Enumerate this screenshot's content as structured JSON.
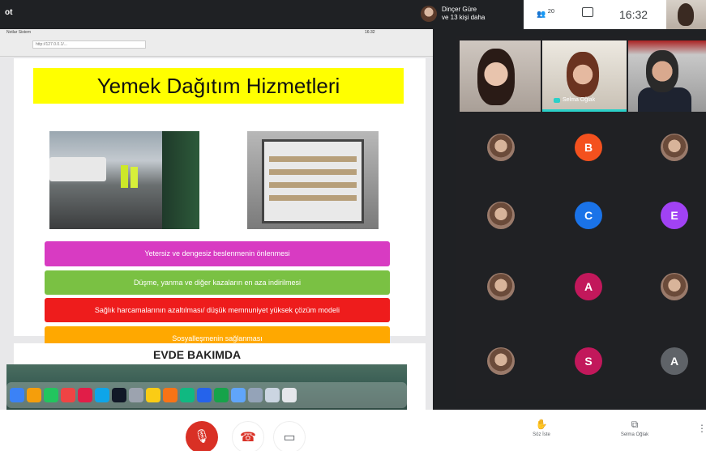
{
  "topbar": {
    "app_label": "ot",
    "presenter": {
      "line1": "Dinçer Güre",
      "line2": "ve 13 kişi daha"
    },
    "people_count": "20",
    "clock": "16:32"
  },
  "screen": {
    "browser_menu": "Notlar  Sistem",
    "url": "http://127.0.0.1/...",
    "clock_mini": "16:32",
    "slide": {
      "title": "Yemek Dağıtım Hizmetleri",
      "bars": [
        {
          "text": "Yetersiz  ve dengesiz beslenmenin önlenmesi",
          "color": "#d83bc2"
        },
        {
          "text": "Düşme, yanma ve diğer kazaların en aza indirilmesi",
          "color": "#7ac143"
        },
        {
          "text": "Sağlık harcamalarının azaltılması/  düşük memnuniyet yüksek çözüm modeli",
          "color": "#ee1c1c"
        },
        {
          "text": "Sosyalleşmenin sağlanması",
          "color": "#ffa800"
        }
      ]
    },
    "slide2_heading": "EVDE BAKIMDA"
  },
  "panel": {
    "tile2_name": "Selma Oğlak",
    "avatars": [
      {
        "letter": "",
        "color": "#7a5a4a",
        "photo": true
      },
      {
        "letter": "B",
        "color": "#f4511e",
        "photo": false
      },
      {
        "letter": "",
        "color": "#6a5a4a",
        "photo": true
      },
      {
        "letter": "",
        "color": "#5a6a4a",
        "photo": true
      },
      {
        "letter": "C",
        "color": "#1a73e8",
        "photo": false
      },
      {
        "letter": "E",
        "color": "#a142f4",
        "photo": false
      },
      {
        "letter": "",
        "color": "#8a6a5a",
        "photo": true
      },
      {
        "letter": "A",
        "color": "#c2185b",
        "photo": false
      },
      {
        "letter": "",
        "color": "#b08a7a",
        "photo": true
      },
      {
        "letter": "",
        "color": "#7a7a7a",
        "photo": true
      },
      {
        "letter": "S",
        "color": "#c2185b",
        "photo": false
      },
      {
        "letter": "A",
        "color": "#5f6368",
        "photo": false
      }
    ]
  },
  "bottombar": {
    "raise_hand_label": "Söz İste",
    "presenting_label": "Selma Oğlak",
    "icons": {
      "mic": "mic-off-icon",
      "hangup": "hang-up-icon",
      "camera": "camera-icon",
      "hand": "raise-hand-icon",
      "present": "present-icon",
      "more": "more-icon"
    }
  }
}
